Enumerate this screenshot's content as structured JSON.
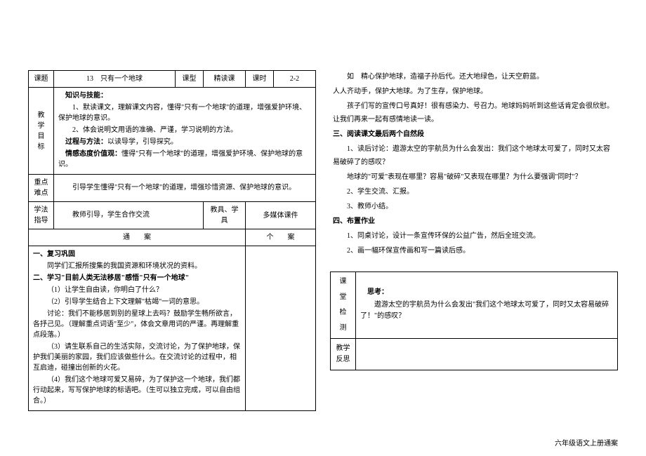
{
  "header": {
    "keti_label": "课题",
    "keti_value": "13　只有一个地球",
    "kexing_label": "课型",
    "kexing_value": "精读课",
    "keshi_label": "课时",
    "keshi_value": "2-2"
  },
  "goals": {
    "label1": "教",
    "label2": "学",
    "label3": "目",
    "label4": "标",
    "sec1_title": "知识与技能：",
    "sec1_l1": "1、默读课文，理解课文内容，懂得\"只有一个地球\"的道理，增强爱护环境、保护地球的意识。",
    "sec1_l2": "2、体会说明文用语的准确、严谨，学习说明的方法。",
    "sec2_title": "过程与方法：",
    "sec2_text": "以读导学，引导探究。",
    "sec3_title": "情感态度价值观：",
    "sec3_text": "懂得\"只有一个地球\"的道理，增强爱护环境、保护地球的意识。"
  },
  "keypoint": {
    "l1": "重点",
    "l2": "难点",
    "text": "引导学生懂得\"只有一个地球\"的道理，增强珍惜资源、保护地球的意识。"
  },
  "method": {
    "l1": "学法",
    "l2": "指导",
    "text": "教师引导，学生合作交流",
    "tool_label": "教具、学具",
    "tool_value": "多媒体课件"
  },
  "plan": {
    "tong": "通　　案",
    "ge": "个　　案"
  },
  "left_content": {
    "h1": "一、复习巩固",
    "p1": "同学们汇报所搜集的我国资源和环境状况的资料。",
    "h2": "二、学习\"目前人类无法移居\"感悟\"只有一个地球\"",
    "p2": "（1）让学生自由读，你明白了什么？",
    "p3": "（2）引导学生结合上下文理解\"枯竭\"一词的意思。",
    "p4": "讨论：我们不能移居到别的星球上去吗？鼓励学生畅所欲言，各抒己见。（理解重点词语\"至少\"，体会文章用词的严谨。再理解重点段落。）",
    "p5": "（3）请生联系自己的生活实际，交流讨论，为了保护地球，保护我们美丽的家园，我们应该做些什么。在交流讨论的过程中，相互启迪，碰撞出创新的火花。",
    "p6": "（4）我们这个地球可爱又易碎，为了保护这一个地球，我们都行动起来，写写保护地球的标语吧。（生可以独立完成，可以自由组合。）"
  },
  "right_content": {
    "p0a": "如　精心保护地球，造福子孙后代。还大地绿色，让天空蔚蓝。",
    "p0b": "人人齐动手，保护大地球。为了生存，保护地球。",
    "p1": "孩子们写的宣传口号真好！很有感染力、号召力。地球妈妈听到这些话肯定会很欣慰。让我们再来一起有感情地读一读。",
    "h3": "三、阅读课文最后两个自然段",
    "p2": "1、读后讨论：遨游太空的宇航员为什么会发出：我们这个地球太可爱了，同时又太容易破碎了的感叹？",
    "p3": "地球的\"可爱\"表现在哪里？容易\"破碎\"又表现在哪里？为什么要强调\"同时\"？",
    "p4": "2、学生交流、汇报。",
    "p5": "3、教师小结。",
    "h4": "四、布置作业",
    "p6": "1、同桌讨论，设计一条宣传环保的公益广告，然后全班交流。",
    "p7": "2、画一幅环保宣传画和写一篇读后感。"
  },
  "check": {
    "l1": "课",
    "l2": "堂",
    "l3": "检",
    "l4": "测",
    "title": "思考：",
    "text": "遨游太空的宇航员为什么会发出\"我们这个地球太可爱了，同时又太容易破碎了！\"的感叹？"
  },
  "reflect": {
    "l1": "教学",
    "l2": "反思"
  },
  "footer": "六年级语文上册通案"
}
